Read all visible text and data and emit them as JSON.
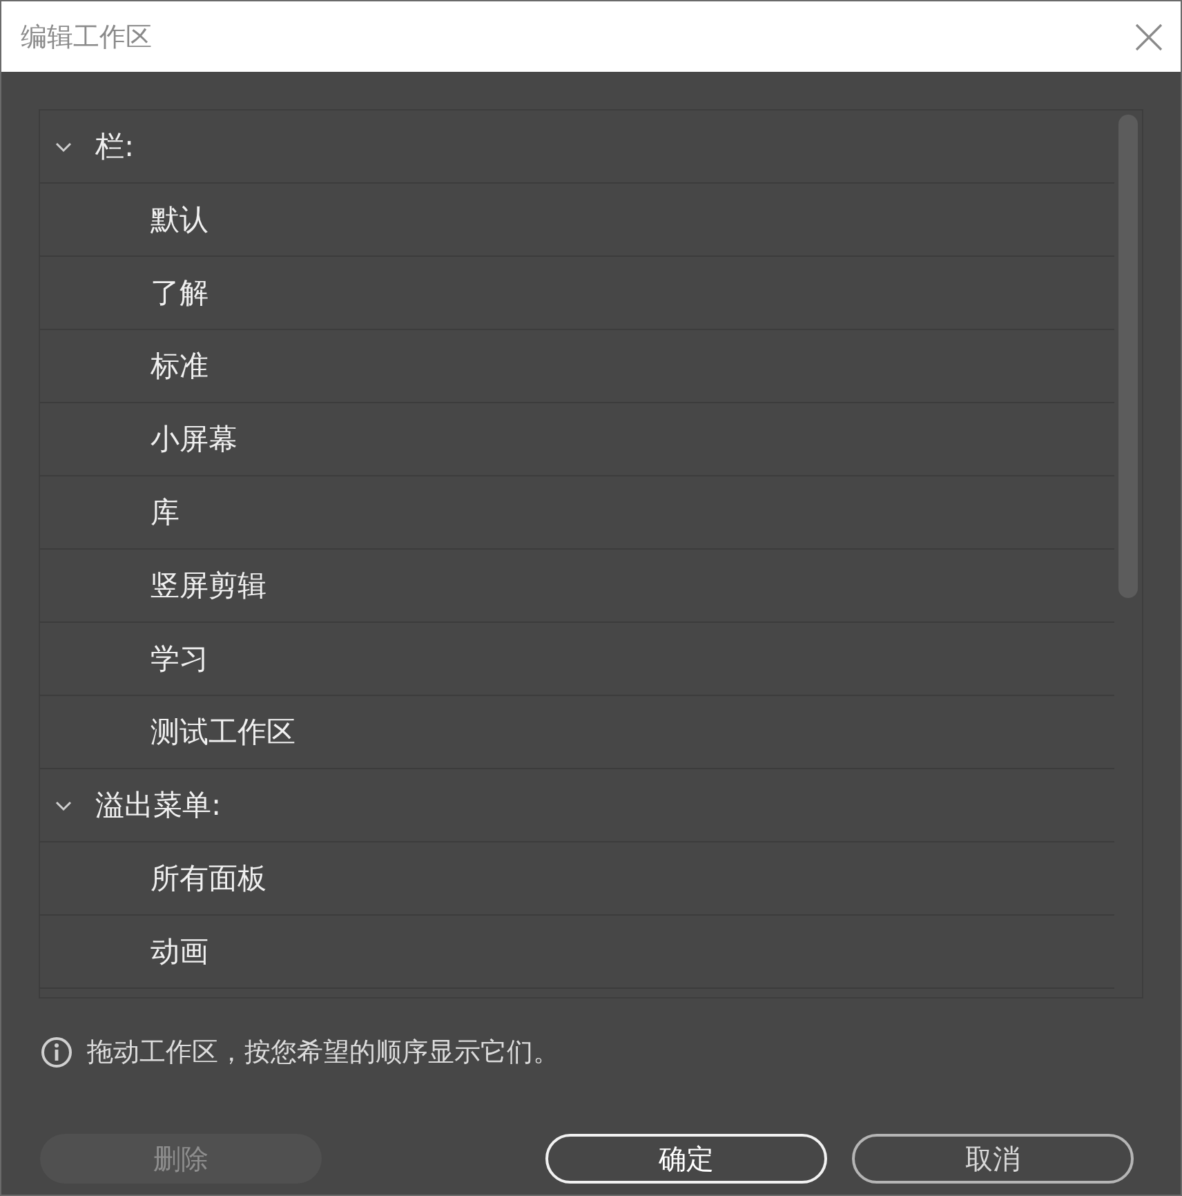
{
  "window": {
    "title": "编辑工作区"
  },
  "groups": [
    {
      "label": "栏:",
      "expanded": true,
      "children": [
        {
          "label": "默认"
        },
        {
          "label": "了解"
        },
        {
          "label": "标准"
        },
        {
          "label": "小屏幕"
        },
        {
          "label": "库"
        },
        {
          "label": "竖屏剪辑"
        },
        {
          "label": "学习"
        },
        {
          "label": "测试工作区"
        }
      ]
    },
    {
      "label": "溢出菜单:",
      "expanded": true,
      "children": [
        {
          "label": "所有面板"
        },
        {
          "label": "动画"
        }
      ]
    }
  ],
  "hint": "拖动工作区，按您希望的顺序显示它们。",
  "buttons": [
    {
      "label": "删除",
      "disabled": true,
      "kind": "secondary"
    },
    {
      "label": "确定",
      "disabled": false,
      "kind": "primary"
    },
    {
      "label": "取消",
      "disabled": false,
      "kind": "secondary"
    }
  ]
}
